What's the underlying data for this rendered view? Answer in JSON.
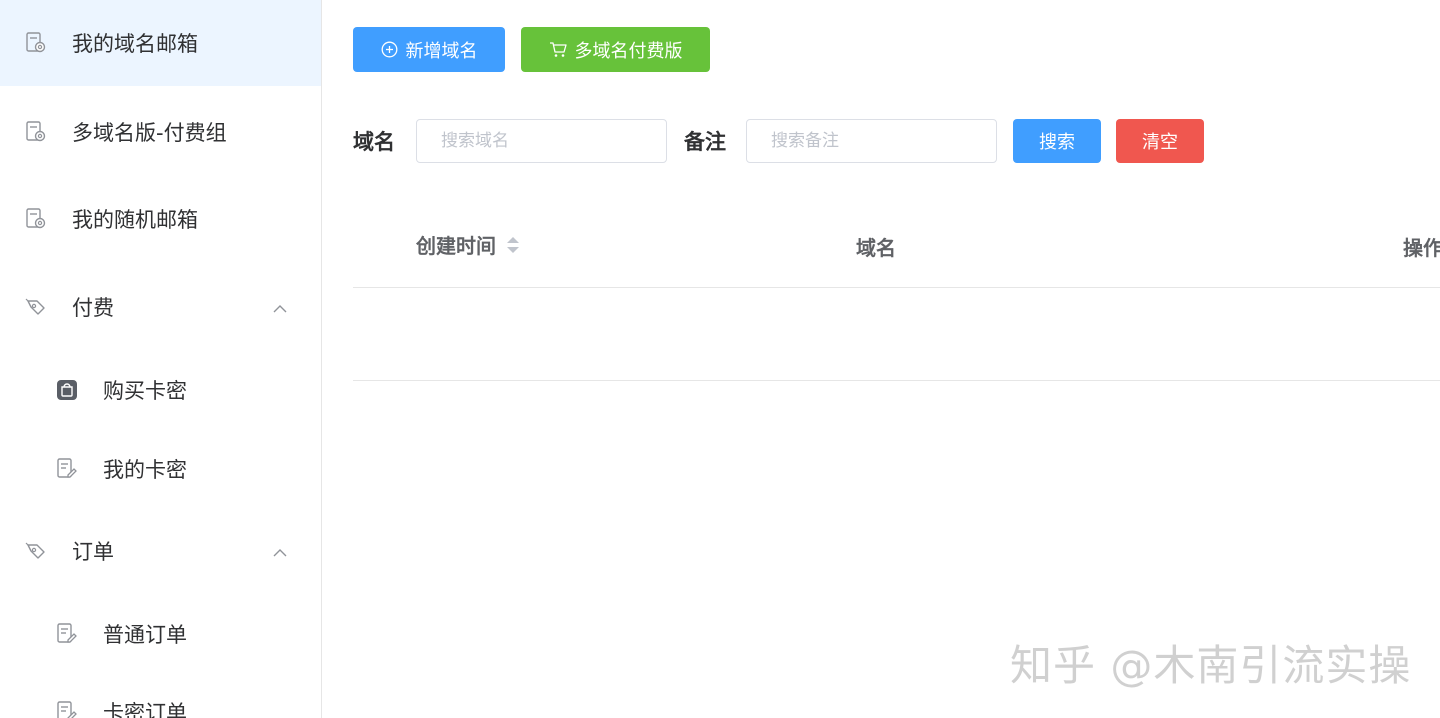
{
  "sidebar": {
    "items": [
      {
        "label": "我的域名邮箱",
        "icon": "mail-doc-icon"
      },
      {
        "label": "多域名版-付费组",
        "icon": "mail-doc-icon"
      },
      {
        "label": "我的随机邮箱",
        "icon": "mail-doc-icon"
      },
      {
        "label": "付费",
        "icon": "tag-icon"
      },
      {
        "label": "购买卡密",
        "icon": "shopping-bag-icon"
      },
      {
        "label": "我的卡密",
        "icon": "document-edit-icon"
      },
      {
        "label": "订单",
        "icon": "tag-icon"
      },
      {
        "label": "普通订单",
        "icon": "document-edit-icon"
      },
      {
        "label": "卡密订单",
        "icon": "document-edit-icon"
      }
    ]
  },
  "toolbar": {
    "add_domain_label": "新增域名",
    "multi_domain_paid_label": "多域名付费版"
  },
  "search": {
    "domain_label": "域名",
    "domain_placeholder": "搜索域名",
    "remark_label": "备注",
    "remark_placeholder": "搜索备注",
    "search_button": "搜索",
    "clear_button": "清空"
  },
  "table": {
    "columns": [
      "创建时间",
      "域名",
      "操作"
    ]
  },
  "watermark": "知乎 @木南引流实操",
  "colors": {
    "primary": "#409eff",
    "success": "#67c23a",
    "danger": "#f0574f",
    "active_bg": "#ecf5ff"
  }
}
